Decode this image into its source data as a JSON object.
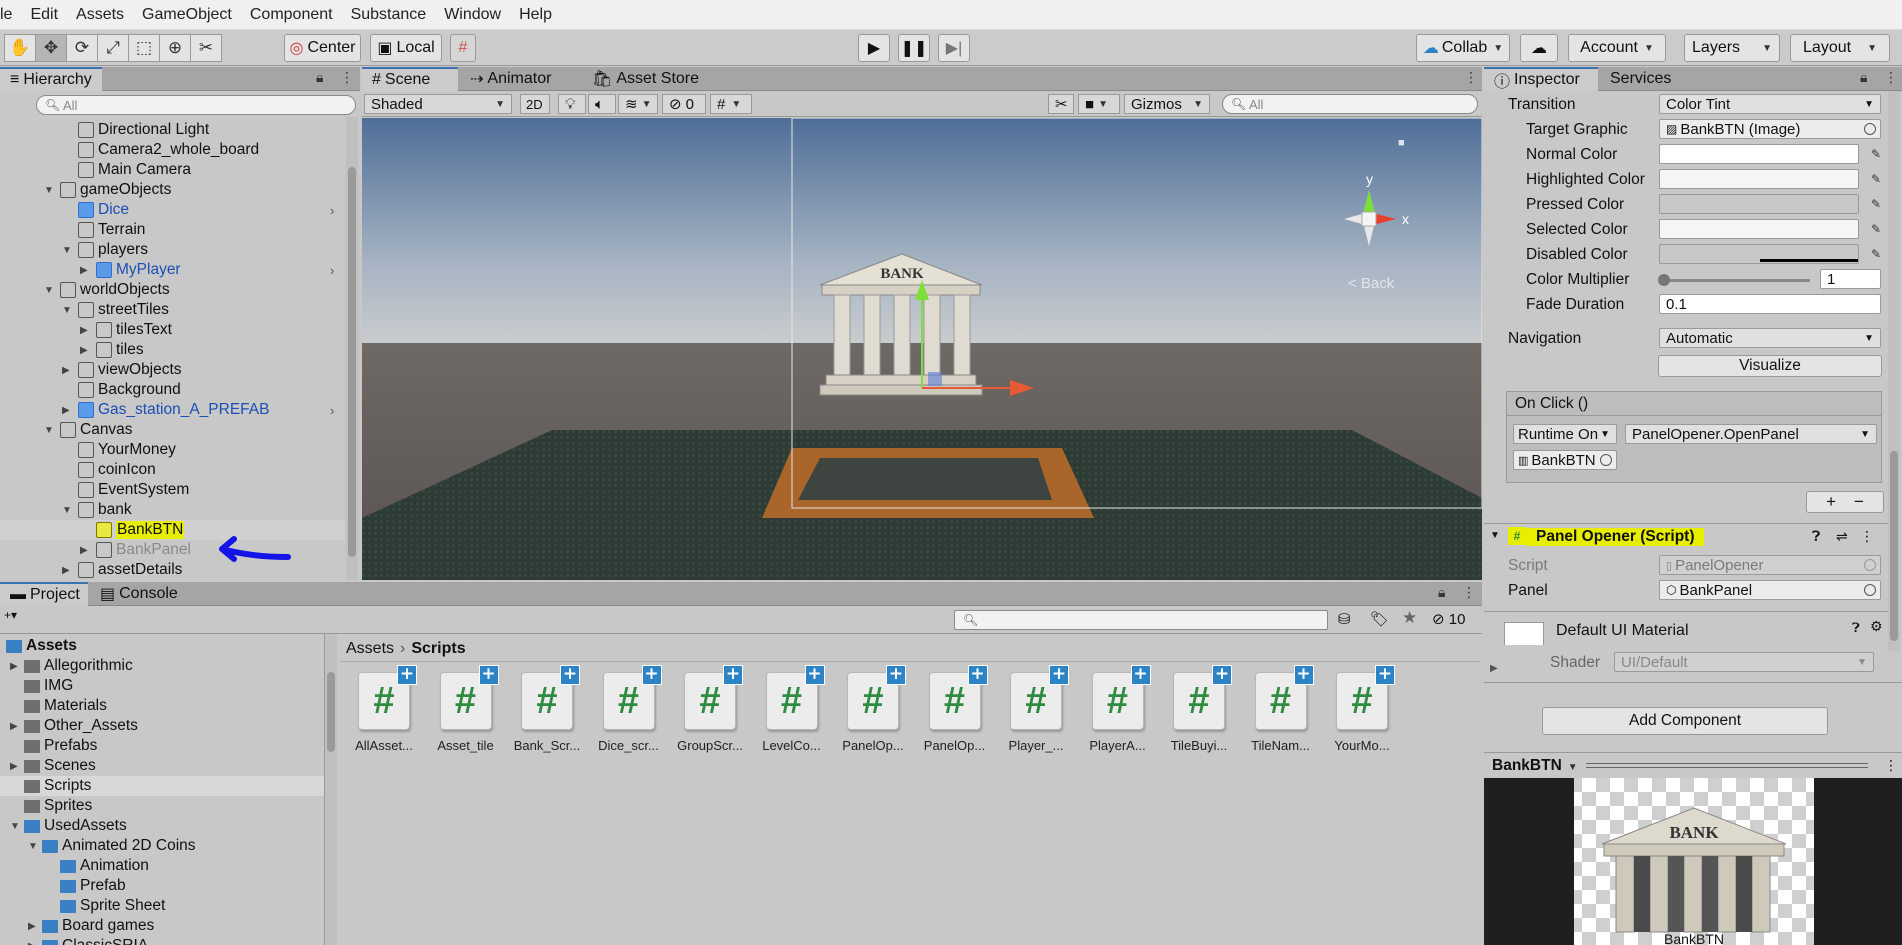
{
  "menu": [
    "le",
    "Edit",
    "Assets",
    "GameObject",
    "Component",
    "Substance",
    "Window",
    "Help"
  ],
  "toolbar": {
    "pivot_label": "Center",
    "space_label": "Local",
    "collab_label": "Collab",
    "account_label": "Account",
    "layers_label": "Layers",
    "layout_label": "Layout"
  },
  "hierarchy": {
    "tab": "Hierarchy",
    "search_placeholder": "All",
    "items": [
      {
        "label": "Directional Light"
      },
      {
        "label": "Camera2_whole_board"
      },
      {
        "label": "Main Camera"
      },
      {
        "label": "gameObjects"
      },
      {
        "label": "Dice"
      },
      {
        "label": "Terrain"
      },
      {
        "label": "players"
      },
      {
        "label": "MyPlayer"
      },
      {
        "label": "worldObjects"
      },
      {
        "label": "streetTiles"
      },
      {
        "label": "tilesText"
      },
      {
        "label": "tiles"
      },
      {
        "label": "viewObjects"
      },
      {
        "label": "Background"
      },
      {
        "label": "Gas_station_A_PREFAB"
      },
      {
        "label": "Canvas"
      },
      {
        "label": "YourMoney"
      },
      {
        "label": "coinIcon"
      },
      {
        "label": "EventSystem"
      },
      {
        "label": "bank"
      },
      {
        "label": "BankBTN"
      },
      {
        "label": "BankPanel"
      },
      {
        "label": "assetDetails"
      }
    ]
  },
  "scene": {
    "tabs": [
      "Scene",
      "Animator",
      "Asset Store"
    ],
    "shading": "Shaded",
    "mode_2d": "2D",
    "hidden_count": "0",
    "gizmos": "Gizmos",
    "search_placeholder": "All",
    "back_label": "< Back",
    "gizmo_x": "x",
    "gizmo_y": "y",
    "bank_text": "BANK"
  },
  "project": {
    "tabs": [
      "Project",
      "Console"
    ],
    "count": "10",
    "breadcrumb_root": "Assets",
    "breadcrumb_current": "Scripts",
    "folders": [
      {
        "label": "Assets"
      },
      {
        "label": "Allegorithmic"
      },
      {
        "label": "IMG"
      },
      {
        "label": "Materials"
      },
      {
        "label": "Other_Assets"
      },
      {
        "label": "Prefabs"
      },
      {
        "label": "Scenes"
      },
      {
        "label": "Scripts"
      },
      {
        "label": "Sprites"
      },
      {
        "label": "UsedAssets"
      },
      {
        "label": "Animated 2D Coins"
      },
      {
        "label": "Animation"
      },
      {
        "label": "Prefab"
      },
      {
        "label": "Sprite Sheet"
      },
      {
        "label": "Board games"
      },
      {
        "label": "ClassicSRIA"
      }
    ],
    "assets": [
      {
        "label": "AllAsset..."
      },
      {
        "label": "Asset_tile"
      },
      {
        "label": "Bank_Scr..."
      },
      {
        "label": "Dice_scr..."
      },
      {
        "label": "GroupScr..."
      },
      {
        "label": "LevelCo..."
      },
      {
        "label": "PanelOp..."
      },
      {
        "label": "PanelOp..."
      },
      {
        "label": "Player_..."
      },
      {
        "label": "PlayerA..."
      },
      {
        "label": "TileBuyi..."
      },
      {
        "label": "TileNam..."
      },
      {
        "label": "YourMo..."
      }
    ]
  },
  "inspector": {
    "tabs": [
      "Inspector",
      "Services"
    ],
    "transition_label": "Transition",
    "transition_value": "Color Tint",
    "target_graphic_label": "Target Graphic",
    "target_graphic_value": "BankBTN (Image)",
    "normal_color_label": "Normal Color",
    "highlighted_color_label": "Highlighted Color",
    "pressed_color_label": "Pressed Color",
    "selected_color_label": "Selected Color",
    "disabled_color_label": "Disabled Color",
    "color_multiplier_label": "Color Multiplier",
    "color_multiplier_value": "1",
    "fade_duration_label": "Fade Duration",
    "fade_duration_value": "0.1",
    "navigation_label": "Navigation",
    "navigation_value": "Automatic",
    "visualize_label": "Visualize",
    "onclick_label": "On Click ()",
    "runtime_label": "Runtime On",
    "function_label": "PanelOpener.OpenPanel",
    "object_label": "BankBTN",
    "script_section": "Panel Opener (Script)",
    "script_label": "Script",
    "script_value": "PanelOpener",
    "panel_label": "Panel",
    "panel_value": "BankPanel",
    "material_title": "Default UI Material",
    "shader_label": "Shader",
    "shader_value": "UI/Default",
    "add_component": "Add Component",
    "preview_title": "BankBTN",
    "preview_bank_text": "BANK",
    "preview_caption": "BankBTN"
  },
  "colors": {
    "highlight": "#e8ee00",
    "annotation_arrow": "#1414e6",
    "prefab_text": "#1a4fb3"
  }
}
